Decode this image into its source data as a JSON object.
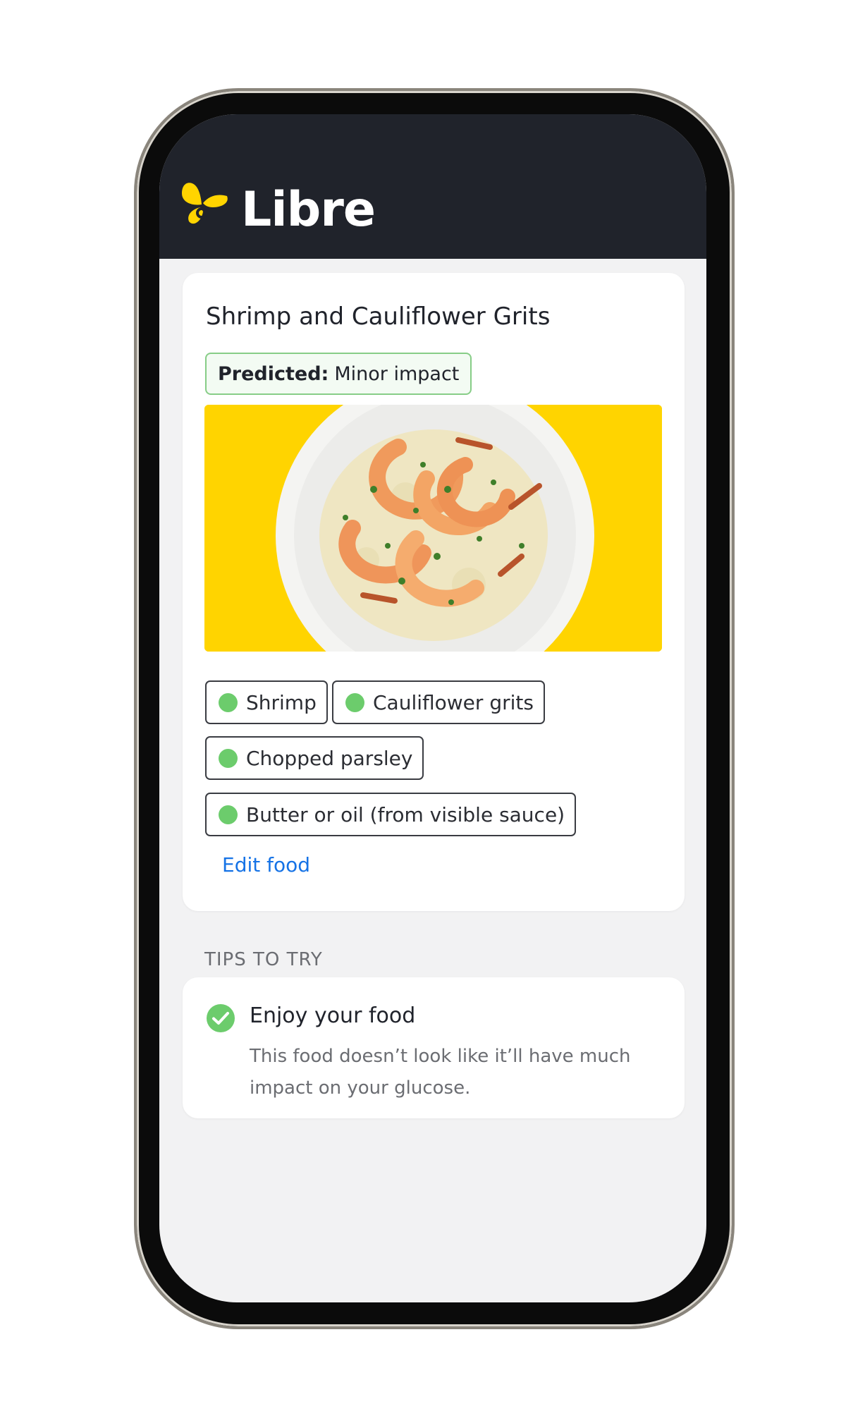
{
  "app": {
    "brand": "Libre"
  },
  "food": {
    "title": "Shrimp and Cauliflower Grits",
    "predicted_label": "Predicted:",
    "predicted_value": "Minor impact",
    "ingredients": [
      {
        "label": "Shrimp"
      },
      {
        "label": "Cauliflower grits"
      },
      {
        "label": "Chopped parsley"
      },
      {
        "label": "Butter or oil (from visible sauce)"
      }
    ],
    "edit_label": "Edit food"
  },
  "tips": {
    "heading": "TIPS TO TRY",
    "items": [
      {
        "title": "Enjoy your food",
        "body": "This food doesn’t look like it’ll have much impact on your glucose."
      }
    ]
  },
  "colors": {
    "header_bg": "#20232b",
    "brand_yellow": "#ffd400",
    "badge_green": "#87cd87",
    "dot_green": "#6ccc6c",
    "link_blue": "#1673e6"
  }
}
